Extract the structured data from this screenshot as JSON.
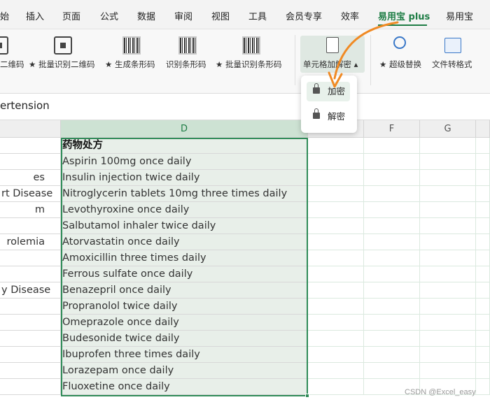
{
  "tabs": [
    "始",
    "插入",
    "页面",
    "公式",
    "数据",
    "审阅",
    "视图",
    "工具",
    "会员专享",
    "效率",
    "易用宝 plus",
    "易用宝"
  ],
  "active_tab": "易用宝 plus",
  "ribbon": {
    "items": [
      {
        "label": "二维码",
        "icon": "qr-code-icon"
      },
      {
        "label": "★ 批量识别二维码",
        "icon": "qr-scan-icon"
      },
      {
        "label": "★ 生成条形码",
        "icon": "barcode-icon"
      },
      {
        "label": "识别条形码",
        "icon": "barcode-scan-icon"
      },
      {
        "label": "★ 批量识别条形码",
        "icon": "barcode-batch-icon"
      },
      {
        "label": "单元格加解密 ▴",
        "icon": "cell-encrypt-icon"
      },
      {
        "label": "★ 超级替换",
        "icon": "super-replace-icon"
      },
      {
        "label": "文件转格式",
        "icon": "file-convert-icon"
      }
    ]
  },
  "formula_bar": {
    "value": "ertension"
  },
  "columns": {
    "d": "D",
    "f": "F",
    "g": "G"
  },
  "column_c_values": [
    "",
    "es",
    "rt Disease",
    "m",
    "",
    "rolemia",
    "",
    "",
    "y Disease",
    "",
    "",
    "",
    "",
    "",
    ""
  ],
  "column_d_header": "药物处方",
  "column_d_values": [
    "Aspirin 100mg once daily",
    "Insulin injection twice daily",
    "Nitroglycerin tablets 10mg three times daily",
    "Levothyroxine once daily",
    "Salbutamol inhaler twice daily",
    "Atorvastatin once daily",
    "Amoxicillin three times daily",
    "Ferrous sulfate once daily",
    "Benazepril once daily",
    "Propranolol twice daily",
    "Omeprazole once daily",
    "Budesonide twice daily",
    "Ibuprofen three times daily",
    "Lorazepam once daily",
    "Fluoxetine once daily"
  ],
  "dropdown": {
    "encrypt": "加密",
    "decrypt": "解密"
  },
  "watermark": "CSDN @Excel_easy",
  "colors": {
    "accent": "#1e7d45",
    "arrow": "#f08a24",
    "selection": "#2e8b57"
  }
}
